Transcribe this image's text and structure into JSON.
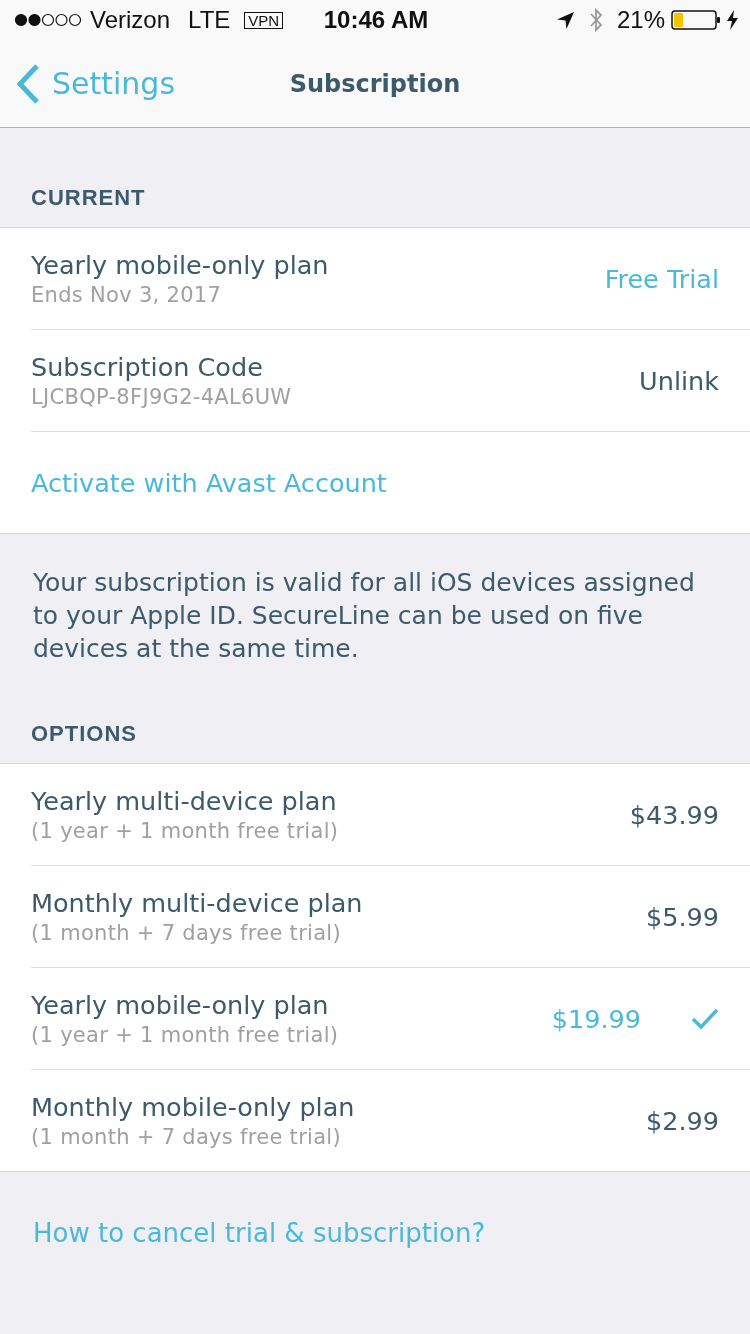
{
  "status_bar": {
    "carrier": "Verizon",
    "network": "LTE",
    "vpn": "VPN",
    "time": "10:46 AM",
    "battery": "21%"
  },
  "nav": {
    "back": "Settings",
    "title": "Subscription"
  },
  "current": {
    "header": "CURRENT",
    "rows": [
      {
        "kind": "status",
        "title": "Yearly mobile-only plan",
        "subtitle": "Ends Nov 3, 2017",
        "value": "Free Trial"
      },
      {
        "kind": "action",
        "title": "Subscription Code",
        "subtitle": "LJCBQP-8FJ9G2-4AL6UW",
        "value": "Unlink"
      },
      {
        "kind": "link",
        "title": "Activate with Avast Account"
      }
    ],
    "footer": "Your subscription is valid for all iOS devices assigned to your Apple ID. SecureLine can be used on five devices at the same time."
  },
  "options": {
    "header": "OPTIONS",
    "plans": [
      {
        "name": "Yearly multi-device plan",
        "detail": "(1 year + 1 month free trial)",
        "price": "$43.99",
        "selected": false
      },
      {
        "name": "Monthly multi-device plan",
        "detail": "(1 month + 7 days free trial)",
        "price": "$5.99",
        "selected": false
      },
      {
        "name": "Yearly mobile-only plan",
        "detail": "(1 year + 1 month free trial)",
        "price": "$19.99",
        "selected": true
      },
      {
        "name": "Monthly mobile-only plan",
        "detail": "(1 month + 7 days free trial)",
        "price": "$2.99",
        "selected": false
      }
    ]
  },
  "help_link": "How to cancel trial & subscription?"
}
